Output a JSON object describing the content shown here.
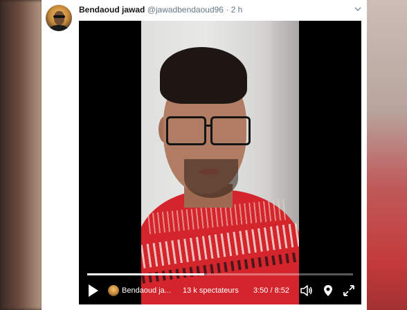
{
  "tweet": {
    "display_name": "Bendaoud jawad",
    "handle": "@jawadbendaoud96",
    "separator": "·",
    "time": "2 h"
  },
  "icons": {
    "more": "chevron-down-icon",
    "play": "play-icon",
    "volume": "volume-icon",
    "location": "location-pin-icon",
    "fullscreen": "fullscreen-icon"
  },
  "player": {
    "broadcaster": "Bendaoud ja...",
    "viewers": "13 k spectateurs",
    "time": "3:50 / 8:52",
    "progress": 0.44
  },
  "colors": {
    "card_bg": "#ffffff",
    "name": "#14171a",
    "meta": "#657786",
    "video_bg": "#000000",
    "shirt": "#d4252d"
  }
}
